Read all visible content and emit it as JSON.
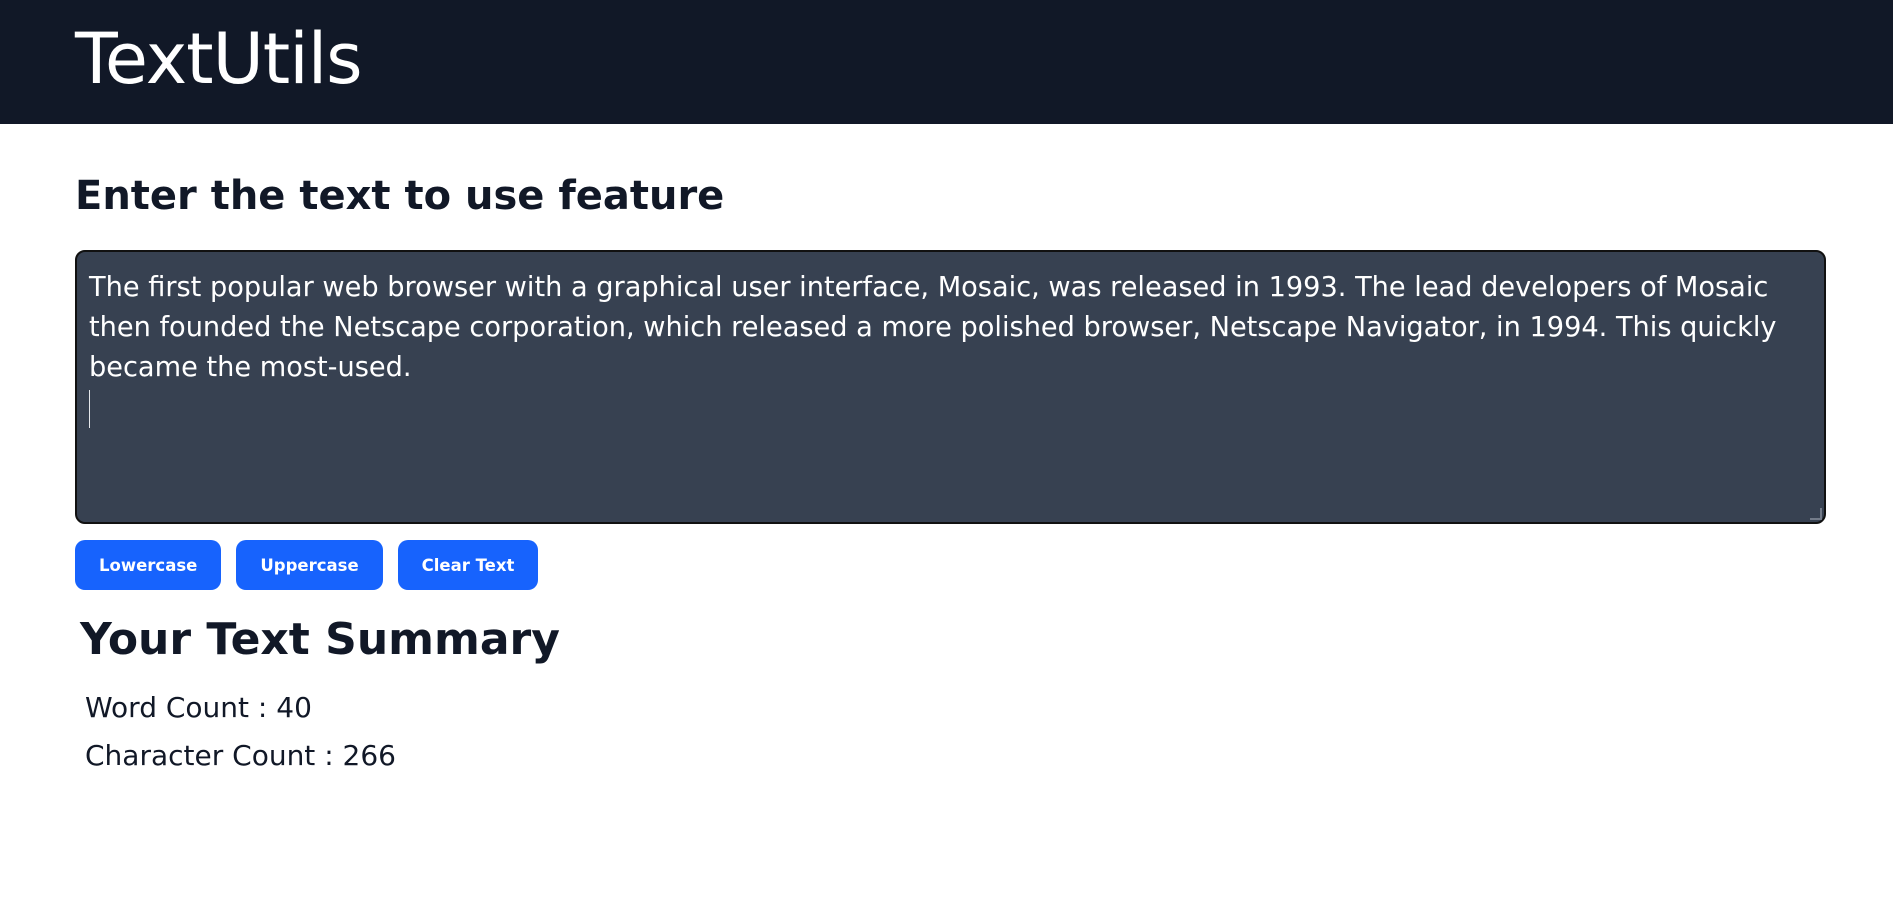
{
  "navbar": {
    "brand": "TextUtils"
  },
  "main": {
    "heading": "Enter the text to use feature",
    "textarea_value": "The first popular web browser with a graphical user interface, Mosaic, was released in 1993. The lead developers of Mosaic then founded the Netscape corporation, which released a more polished browser, Netscape Navigator, in 1994. This quickly became the most-used.",
    "buttons": {
      "lowercase": "Lowercase",
      "uppercase": "Uppercase",
      "clear": "Clear Text"
    }
  },
  "summary": {
    "title": "Your Text Summary",
    "word_count_label": "Word Count :",
    "word_count": "40",
    "char_count_label": "Character Count :",
    "char_count": "266"
  },
  "colors": {
    "navbar_bg": "#111827",
    "textarea_bg": "#374151",
    "button_bg": "#1763fd",
    "text_dark": "#111827"
  }
}
